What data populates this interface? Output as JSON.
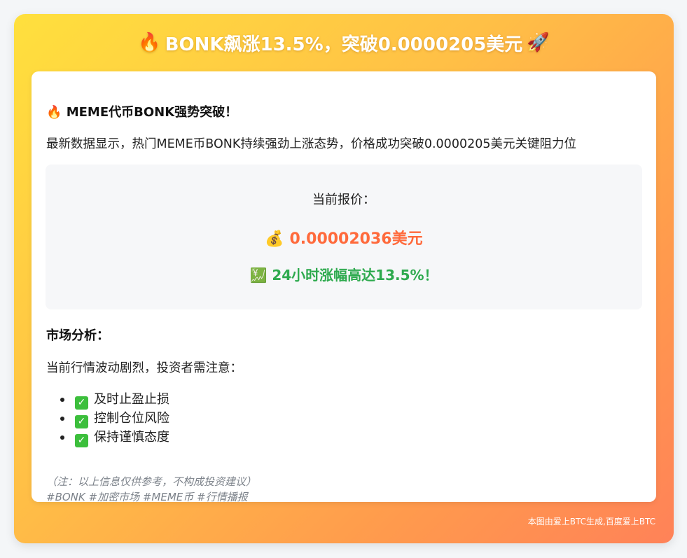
{
  "header": {
    "title": "BONK飙涨13.5%，突破0.0000205美元",
    "left_icon": "fire-icon",
    "right_icon": "rocket-icon"
  },
  "intro": {
    "title": "MEME代币BONK强势突破！",
    "title_icon": "fire-icon",
    "text": "最新数据显示，热门MEME币BONK持续强劲上涨态势，价格成功突破0.0000205美元关键阻力位"
  },
  "price": {
    "label": "当前报价：",
    "value": "0.00002036美元",
    "value_icon": "money-bag-icon",
    "change": "24小时涨幅高达13.5%！",
    "change_icon": "chart-up-icon",
    "value_color": "#ff6a3c",
    "change_color": "#2eaa4e"
  },
  "analysis": {
    "title": "市场分析：",
    "text": "当前行情波动剧烈，投资者需注意：",
    "tips": [
      "及时止盈止损",
      "控制仓位风险",
      "保持谨慎态度"
    ]
  },
  "note": "（注：以上信息仅供参考，不构成投资建议）",
  "tags": "#BONK #加密市场 #MEME币 #行情播报",
  "footer": "本图由爱上BTC生成,百度爱上BTC"
}
